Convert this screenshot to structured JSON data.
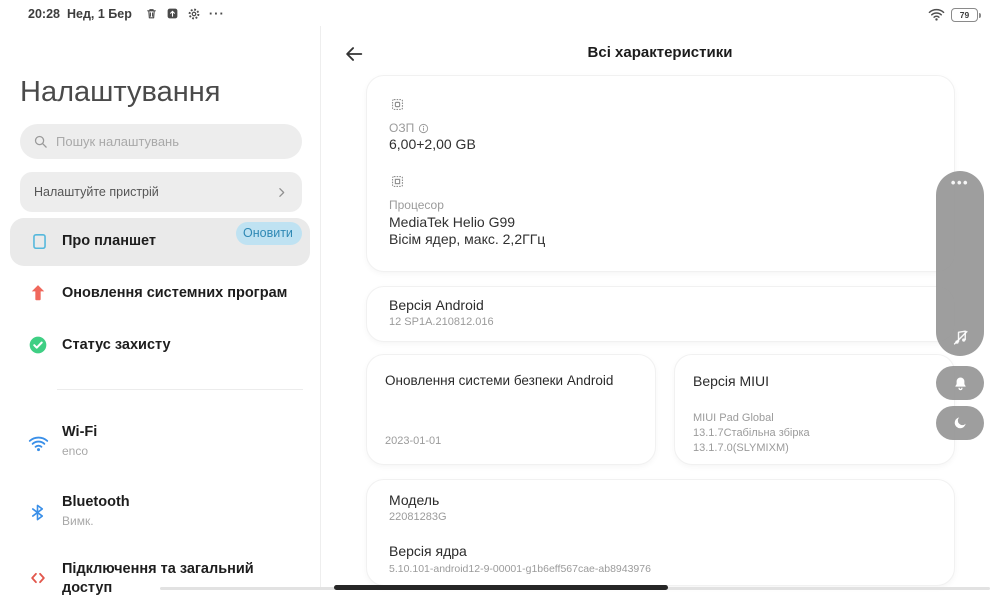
{
  "status_bar": {
    "time": "20:28",
    "date": "Нед, 1 Бер",
    "more": "···",
    "battery_percent": "79"
  },
  "sidebar": {
    "title": "Налаштування",
    "search_placeholder": "Пошук налаштувань",
    "setup_device": "Налаштуйте пристрій",
    "about_tablet": "Про планшет",
    "about_badge": "Оновити",
    "system_updates": "Оновлення системних програм",
    "security_status": "Статус захисту",
    "wifi_label": "Wi-Fi",
    "wifi_value": "enco",
    "bluetooth_label": "Bluetooth",
    "bluetooth_value": "Вимк.",
    "connection_label": "Підключення та загальний доступ"
  },
  "main": {
    "title": "Всі характеристики",
    "ram_label": "ОЗП",
    "ram_value": "6,00+2,00 GB",
    "cpu_label": "Процесор",
    "cpu_line1": "MediaTek Helio G99",
    "cpu_line2": "Вісім ядер, макс. 2,2ГГц",
    "android_label": "Версія Android",
    "android_value": "12 SP1A.210812.016",
    "security_label": "Оновлення системи безпеки Android",
    "security_value": "2023-01-01",
    "miui_label": "Версія MIUI",
    "miui_line1": "MIUI Pad Global",
    "miui_line2": "13.1.7Стабільна збірка",
    "miui_line3": "13.1.7.0(SLYMIXM)",
    "model_label": "Модель",
    "model_value": "22081283G",
    "kernel_label": "Версія ядра",
    "kernel_value": "5.10.101-android12-9-00001-g1b6eff567cae-ab8943976"
  },
  "side_toolbar": {
    "handle_dots": "•••"
  },
  "colors": {
    "accent_blue": "#3a8fe8",
    "tablet_icon_blue": "#55b8dc",
    "badge_bg": "#bfe2f2",
    "badge_text": "#2f89b5",
    "update_red": "#f0685c",
    "shield_green": "#3fcf84",
    "connection_red": "#e2574c",
    "pill_gray": "#969696",
    "home_bar_dark": "#262626"
  },
  "icons": {
    "trash": "trash-can glyph",
    "screenshot_share": "square with up arrow",
    "gear": "settings gear",
    "wifi": "wifi arcs",
    "battery": "battery outline with percent",
    "search": "magnifier",
    "chevron_right": "›",
    "tablet": "rounded rectangle outline",
    "arrow_up": "solid upward arrow",
    "shield_check": "circle with checkmark",
    "bluetooth": "bluetooth rune",
    "connection": "double chevrons",
    "chip": "processor chip outline",
    "info": "circled i",
    "back_arrow": "←",
    "music_off": "note with slash",
    "bell": "notification bell",
    "moon": "crescent moon"
  }
}
